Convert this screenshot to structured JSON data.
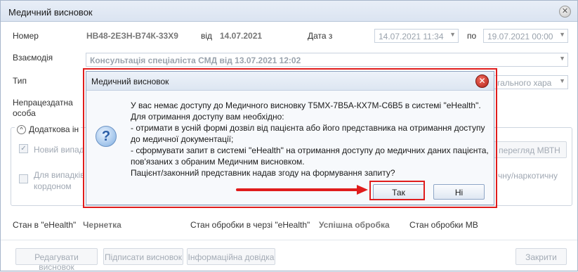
{
  "window": {
    "title": "Медичний висновок",
    "close_glyph": "✕"
  },
  "form": {
    "number_label": "Номер",
    "number_value": "НВ48-2ЕЗН-В74К-33Х9",
    "from_label": "від",
    "from_value": "14.07.2021",
    "date_from_label": "Дата з",
    "date_from_value": "14.07.2021 11:34",
    "to_label": "по",
    "date_to_value": "19.07.2021 00:00",
    "interaction_label": "Взаємодія",
    "interaction_value": "Консультація спеціаліста СМД від 13.07.2021 12:02",
    "type_label": "Тип",
    "type_value_partial": "гального хара",
    "disabled_label_line1": "Непрацездатна",
    "disabled_label_line2": "особа",
    "additional_info_label": "Додаткова ін",
    "new_case_label": "Новий випад",
    "cases_label_line1": "Для випадків",
    "cases_label_line2": "кордоном",
    "mvtn_button": "перегляд МВТН",
    "narcotic_text": "чну/наркотичну"
  },
  "status": {
    "ehealth_label": "Стан в \"eHealth\"",
    "ehealth_value": "Чернетка",
    "queue_label": "Стан обробки в черзі \"eHealth\"",
    "queue_value": "Успішна обробка",
    "mv_label": "Стан обробки МВ"
  },
  "footer": {
    "edit_button": "Редагувати висновок",
    "sign_button": "Підписати висновок",
    "info_button": "Інформаційна довідка",
    "close_button": "Закрити"
  },
  "dialog": {
    "title": "Медичний висновок",
    "close_glyph": "✕",
    "icon_glyph": "?",
    "lines": [
      "У вас немає доступу до Медичного висновку Т5МХ-7В5А-КХ7М-С6В5 в системі \"eHealth\".",
      "Для отримання доступу вам необхідно:",
      "- отримати в усній формі дозвіл від пацієнта або його представника на отримання доступу",
      "до медичної документації;",
      "- сформувати запит в системі \"eHealth\" на отримання доступу до медичних даних пацієнта,",
      "пов'язаних з обраним Медичним висновком.",
      "Пацієнт/законний представник надав згоду на формування запиту?"
    ],
    "yes_button": "Так",
    "no_button": "Ні"
  },
  "colors": {
    "highlight": "#e01c1c",
    "accent_border": "#8ea6c6"
  }
}
